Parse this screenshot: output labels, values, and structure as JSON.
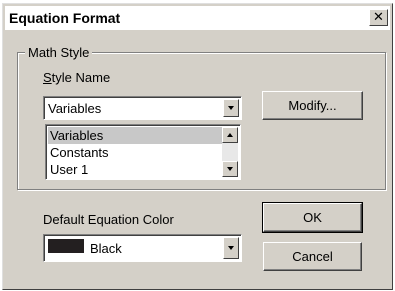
{
  "dialog": {
    "title": "Equation Format",
    "close_label": "✕"
  },
  "math_style": {
    "group_label": "Math Style",
    "style_name_label": "Style Name",
    "selected_value": "Variables",
    "list_items": [
      "Variables",
      "Constants",
      "User 1"
    ],
    "modify_label": "Modify..."
  },
  "color": {
    "label": "Default Equation Color",
    "selected_value": "Black",
    "swatch_color": "#231f20"
  },
  "buttons": {
    "ok_label": "OK",
    "cancel_label": "Cancel"
  }
}
